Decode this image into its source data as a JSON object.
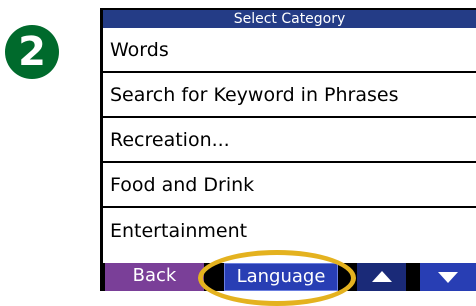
{
  "step_badge": {
    "number": "2"
  },
  "screen": {
    "title": "Select Category",
    "items": [
      {
        "label": "Words"
      },
      {
        "label": "Search for Keyword in Phrases"
      },
      {
        "label": "Recreation..."
      },
      {
        "label": "Food and Drink"
      },
      {
        "label": "Entertainment"
      }
    ]
  },
  "toolbar": {
    "back_label": "Back",
    "language_label": "Language",
    "up_icon": "triangle-up-icon",
    "down_icon": "triangle-down-icon"
  },
  "colors": {
    "badge": "#006a2c",
    "titlebar": "#243c86",
    "back_button": "#7a3f98",
    "language_button": "#283eb4",
    "highlight": "#e4b21f"
  }
}
